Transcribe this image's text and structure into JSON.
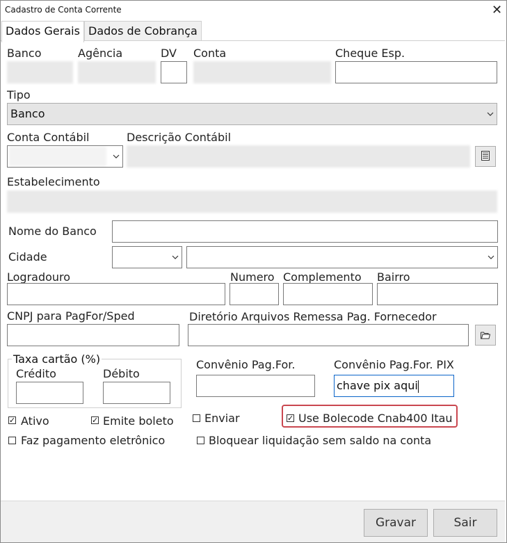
{
  "window": {
    "title": "Cadastro de Conta Corrente",
    "close_glyph": "✕"
  },
  "tabs": [
    {
      "label": "Dados Gerais",
      "active": true
    },
    {
      "label": "Dados de Cobrança",
      "active": false
    }
  ],
  "labels": {
    "banco": "Banco",
    "agencia": "Agência",
    "dv": "DV",
    "conta": "Conta",
    "cheque_esp": "Cheque Esp.",
    "tipo": "Tipo",
    "conta_contabil": "Conta Contábil",
    "descricao_contabil": "Descrição Contábil",
    "estabelecimento": "Estabelecimento",
    "nome_banco": "Nome do Banco",
    "cidade": "Cidade",
    "logradouro": "Logradouro",
    "numero": "Numero",
    "complemento": "Complemento",
    "bairro": "Bairro",
    "cnpj": "CNPJ para PagFor/Sped",
    "diretorio": "Diretório Arquivos Remessa Pag. Fornecedor",
    "taxa_cartao": "Taxa cartão (%)",
    "credito": "Crédito",
    "debito": "Débito",
    "convenio_pagfor": "Convênio Pag.For.",
    "convenio_pix": "Convênio Pag.For. PIX"
  },
  "values": {
    "tipo": "Banco",
    "convenio_pix": "chave pix aqui"
  },
  "checkboxes": {
    "ativo": {
      "label": "Ativo",
      "checked": true
    },
    "emite_boleto": {
      "label": "Emite boleto",
      "checked": true
    },
    "enviar": {
      "label": "Enviar",
      "checked": false
    },
    "bolecode": {
      "label": "Use Bolecode Cnab400 Itau",
      "checked": true
    },
    "faz_pagamento": {
      "label": "Faz pagamento eletrônico",
      "checked": false
    },
    "bloquear": {
      "label": "Bloquear liquidação sem saldo na conta",
      "checked": false
    }
  },
  "buttons": {
    "gravar": "Gravar",
    "sair": "Sair"
  },
  "check_glyph": "✓",
  "accent_colors": {
    "highlight": "#c9474f",
    "focus": "#0a64c8"
  }
}
